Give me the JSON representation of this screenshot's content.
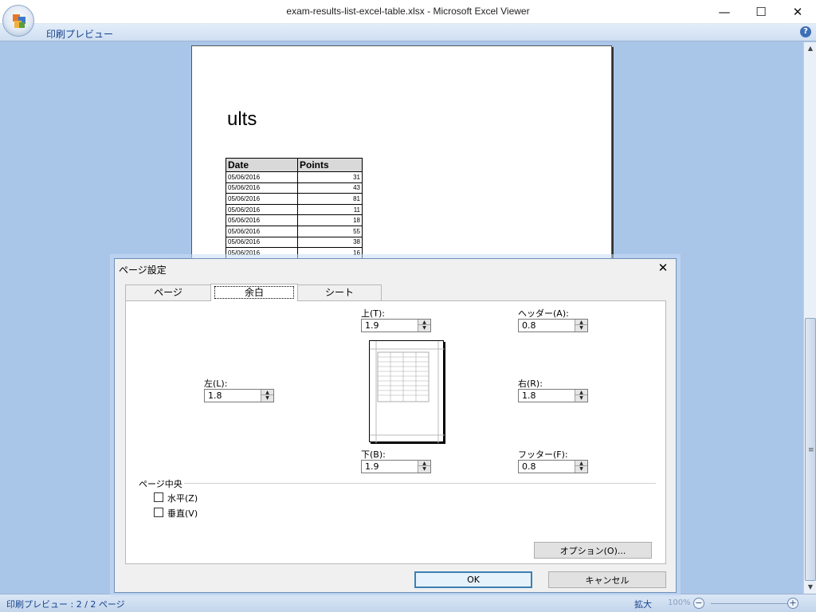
{
  "window": {
    "title": "exam-results-list-excel-table.xlsx - Microsoft Excel Viewer",
    "minimize": "—",
    "maximize": "☐",
    "close": "✕"
  },
  "ribbon": {
    "tab_label": "印刷プレビュー",
    "help": "?"
  },
  "page": {
    "title_fragment": "ults",
    "table": {
      "headers": [
        "Date",
        "Points"
      ],
      "rows": [
        [
          "05/06/2016",
          "31"
        ],
        [
          "05/06/2016",
          "43"
        ],
        [
          "05/06/2016",
          "81"
        ],
        [
          "05/06/2016",
          "11"
        ],
        [
          "05/06/2016",
          "18"
        ],
        [
          "05/06/2016",
          "55"
        ],
        [
          "05/06/2016",
          "38"
        ],
        [
          "05/06/2016",
          "16"
        ]
      ]
    }
  },
  "statusbar": {
    "text": "印刷プレビュー : 2 / 2 ページ",
    "zoom_label": "拡大",
    "zoom_value": "100%",
    "zoom_out": "−",
    "zoom_in": "+"
  },
  "dialog": {
    "title": "ページ設定",
    "close": "✕",
    "tabs": [
      {
        "label": "ページ"
      },
      {
        "label": "余白"
      },
      {
        "label": "シート"
      }
    ],
    "margins": {
      "top": {
        "label": "上(T):",
        "value": "1.9"
      },
      "header": {
        "label": "ヘッダー(A):",
        "value": "0.8"
      },
      "left": {
        "label": "左(L):",
        "value": "1.8"
      },
      "right": {
        "label": "右(R):",
        "value": "1.8"
      },
      "bottom": {
        "label": "下(B):",
        "value": "1.9"
      },
      "footer": {
        "label": "フッター(F):",
        "value": "0.8"
      }
    },
    "center_section": {
      "label": "ページ中央",
      "horizontal": "水平(Z)",
      "vertical": "垂直(V)"
    },
    "options_button": "オプション(O)...",
    "ok_button": "OK",
    "cancel_button": "キャンセル"
  }
}
